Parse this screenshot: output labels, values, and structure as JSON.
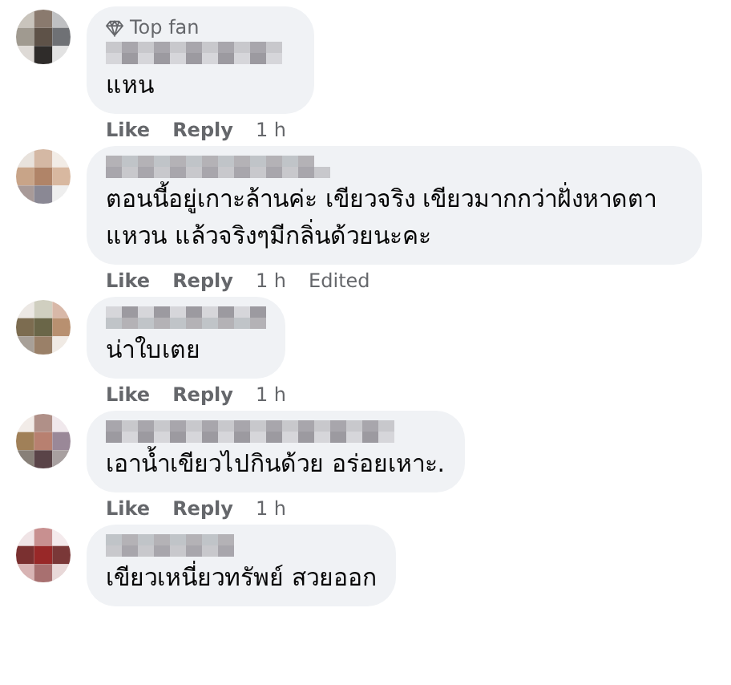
{
  "comments": [
    {
      "badge": "Top fan",
      "text": "แหน",
      "actions": [
        {
          "label": "Like",
          "kind": "link"
        },
        {
          "label": "Reply",
          "kind": "link"
        },
        {
          "label": "1 h",
          "kind": "time"
        }
      ]
    },
    {
      "text": "ตอนนี้อยู่เกาะล้านค่ะ เขียวจริง เขียวมากกว่าฝั่งหาดตาแหวน แล้วจริงๆมีกลิ่นด้วยนะคะ",
      "actions": [
        {
          "label": "Like",
          "kind": "link"
        },
        {
          "label": "Reply",
          "kind": "link"
        },
        {
          "label": "1 h",
          "kind": "time"
        },
        {
          "label": "Edited",
          "kind": "note"
        }
      ]
    },
    {
      "text": "น่าใบเตย",
      "actions": [
        {
          "label": "Like",
          "kind": "link"
        },
        {
          "label": "Reply",
          "kind": "link"
        },
        {
          "label": "1 h",
          "kind": "time"
        }
      ]
    },
    {
      "text": "เอาน้ำเขียวไปกินด้วย อร่อยเหาะ.",
      "actions": [
        {
          "label": "Like",
          "kind": "link"
        },
        {
          "label": "Reply",
          "kind": "link"
        },
        {
          "label": "1 h",
          "kind": "time"
        }
      ]
    },
    {
      "text": "เขียวเหนี่ยวทรัพย์ สวยออก"
    }
  ]
}
